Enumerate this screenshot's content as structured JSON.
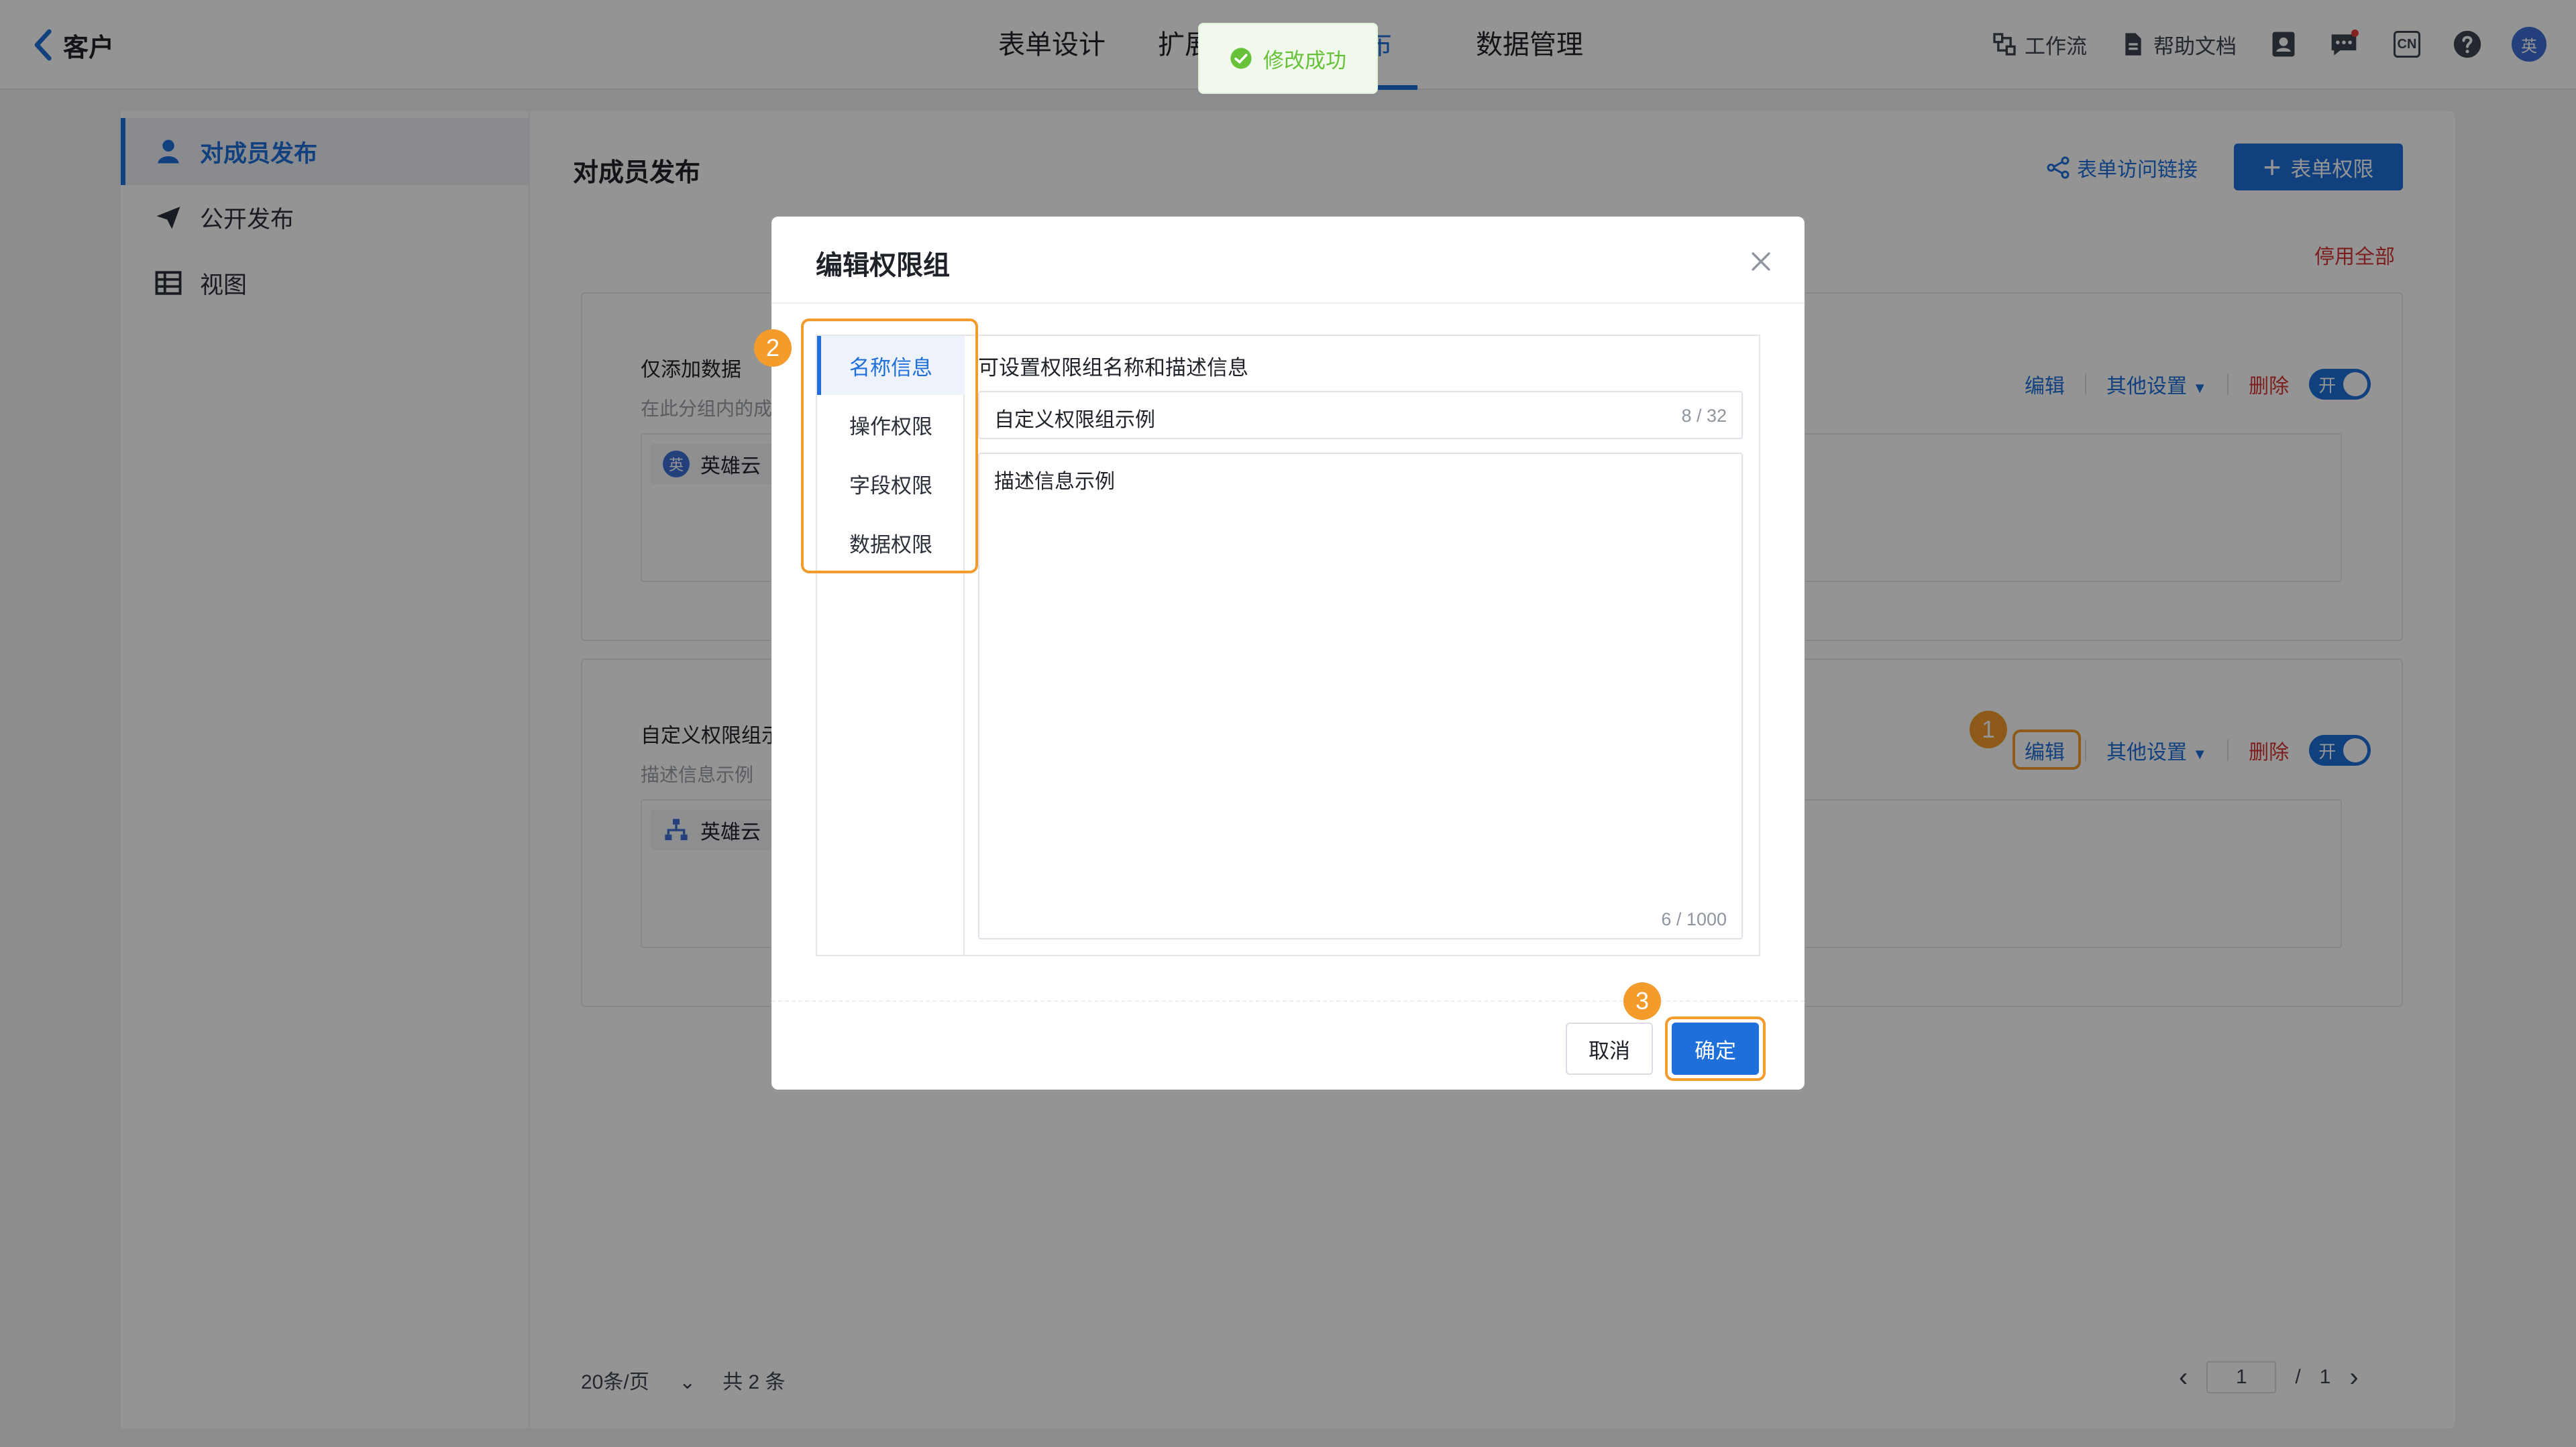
{
  "header": {
    "back_label": "客户",
    "tabs": [
      {
        "label": "表单设计"
      },
      {
        "label": "扩展功能"
      },
      {
        "label": "发布"
      },
      {
        "label": "数据管理"
      }
    ],
    "right": {
      "workflow": "工作流",
      "help_docs": "帮助文档",
      "lang": "CN",
      "avatar_text": "英"
    }
  },
  "toast": {
    "text": "修改成功"
  },
  "sidebar": {
    "items": [
      {
        "label": "对成员发布"
      },
      {
        "label": "公开发布"
      },
      {
        "label": "视图"
      }
    ]
  },
  "main": {
    "title": "对成员发布",
    "access_link": "表单访问链接",
    "form_permission_btn": "表单权限",
    "disable_all": "停用全部",
    "groups": [
      {
        "name": "仅添加数据",
        "desc": "在此分组内的成员可以提交数据",
        "member": "英雄云",
        "avatar": "英",
        "edit": "编辑",
        "other": "其他设置",
        "delete": "删除",
        "toggle": "开"
      },
      {
        "name": "自定义权限组示例",
        "desc": "描述信息示例",
        "member": "英雄云",
        "edit": "编辑",
        "other": "其他设置",
        "delete": "删除",
        "toggle": "开"
      }
    ],
    "pagination": {
      "page_size": "20条/页",
      "total": "共 2 条",
      "current": "1",
      "separator": "/",
      "pages": "1"
    }
  },
  "modal": {
    "title": "编辑权限组",
    "tabs": [
      {
        "label": "名称信息"
      },
      {
        "label": "操作权限"
      },
      {
        "label": "字段权限"
      },
      {
        "label": "数据权限"
      }
    ],
    "hint": "可设置权限组名称和描述信息",
    "name_value": "自定义权限组示例",
    "name_count": "8 / 32",
    "desc_value": "描述信息示例",
    "desc_count": "6 / 1000",
    "cancel": "取消",
    "confirm": "确定"
  },
  "annotations": [
    "1",
    "2",
    "3"
  ],
  "colors": {
    "accent": "#1e6fd9",
    "highlight": "#f39c2c",
    "danger": "#d83535",
    "success": "#67c23a"
  }
}
